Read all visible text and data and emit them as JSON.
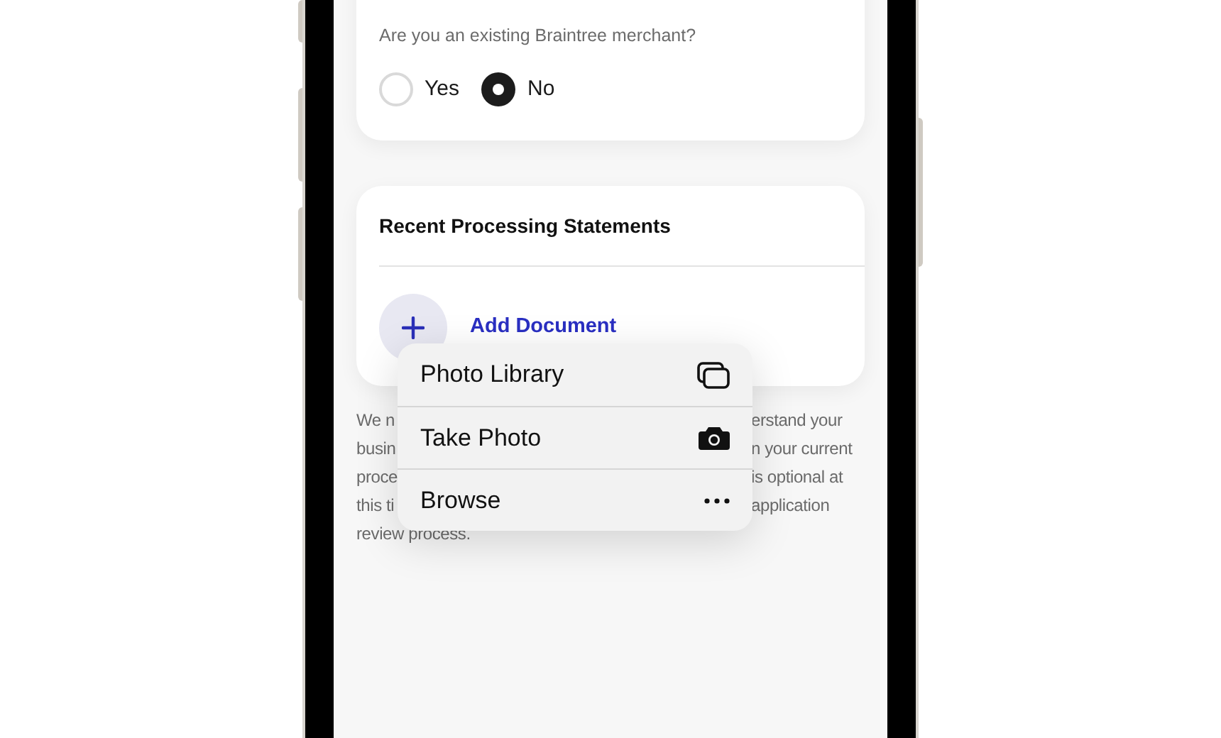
{
  "merchant_question": {
    "label": "Are you an existing Braintree merchant?",
    "options": [
      {
        "label": "Yes",
        "selected": false
      },
      {
        "label": "No",
        "selected": true
      }
    ]
  },
  "statements_card": {
    "title": "Recent Processing Statements",
    "add_button": {
      "label": "Add Document"
    }
  },
  "description_lines": [
    {
      "left": "We n",
      "right": "erstand your"
    },
    {
      "left": "busin",
      "right": "n your current"
    },
    {
      "left": "proce",
      "right": "is optional at"
    },
    {
      "left": "this ti",
      "right": "application"
    },
    {
      "left": "review process."
    }
  ],
  "menu": {
    "items": [
      {
        "kind": "photos",
        "label": "Photo Library"
      },
      {
        "kind": "camera",
        "label": "Take Photo"
      },
      {
        "kind": "more",
        "label": "Browse"
      }
    ]
  }
}
